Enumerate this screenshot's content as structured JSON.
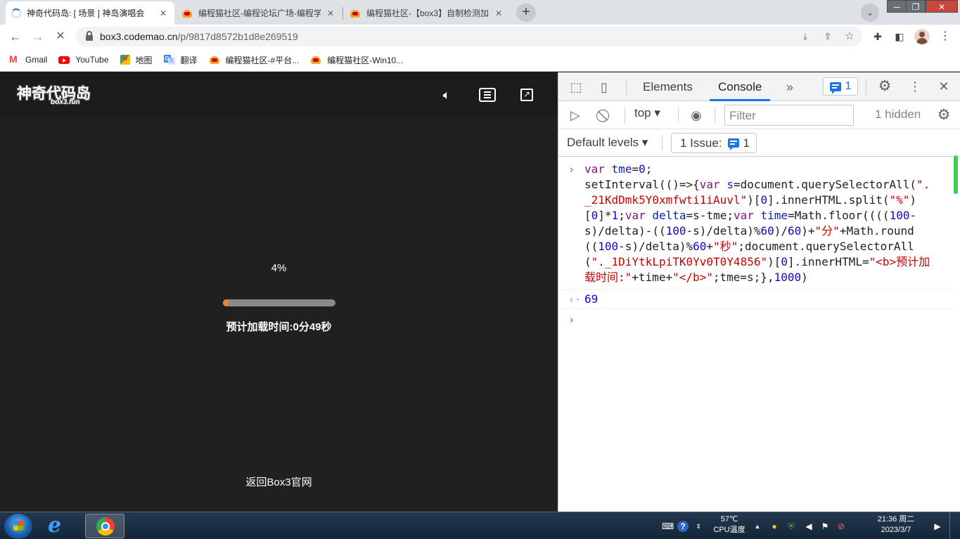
{
  "browser": {
    "tabs": [
      {
        "title": "神奇代码岛: [ 场景 ] 神岛演唱会",
        "active": true,
        "loading": true
      },
      {
        "title": "编程猫社区-编程论坛广场-编程学",
        "active": false
      },
      {
        "title": "编程猫社区-【box3】自制检测加",
        "active": false
      }
    ],
    "url_host": "box3.codemao.cn",
    "url_path": "/p/9817d8572b1d8e269519",
    "bookmarks": [
      "Gmail",
      "YouTube",
      "地图",
      "翻译",
      "编程猫社区-#平台...",
      "编程猫社区-Win10..."
    ]
  },
  "page": {
    "logo_text": "神奇代码岛",
    "logo_sub": "box3.fun",
    "progress_label": "4%",
    "progress_fraction": 0.04,
    "eta_text": "预计加载时间:0分49秒",
    "back_link": "返回Box3官网"
  },
  "devtools": {
    "tabs": [
      "Elements",
      "Console"
    ],
    "active_tab": "Console",
    "message_count": "1",
    "context": "top",
    "filter_placeholder": "Filter",
    "hidden_text": "1 hidden",
    "levels": "Default levels",
    "issues_label": "1 Issue:",
    "issues_count": "1",
    "input_code": "var tme=0;\nsetInterval(()=>{var s=document.querySelectorAll(\"._21KdDmk5Y0xmfwti1iAuvl\")[0].innerHTML.split(\"%\")[0]*1;var delta=s-tme;var time=Math.floor((((100-s)/delta)-((100-s)/delta)%60)/60)+\"分\"+Math.round((100-s)/delta)%60+\"秒\";document.querySelectorAll(\"._1DiYtkLpiTK0Yv0T0Y4856\")[0].innerHTML=\"<b>预计加载时间:\"+time+\"</b>\";tme=s;},1000)",
    "result": "69"
  },
  "taskbar": {
    "temp": "57℃",
    "temp_label": "CPU温度",
    "time": "21:36 周二",
    "date": "2023/3/7"
  },
  "colors": {
    "accent": "#1a73e8",
    "progress": "#f5831f",
    "page_bg": "#202020"
  }
}
